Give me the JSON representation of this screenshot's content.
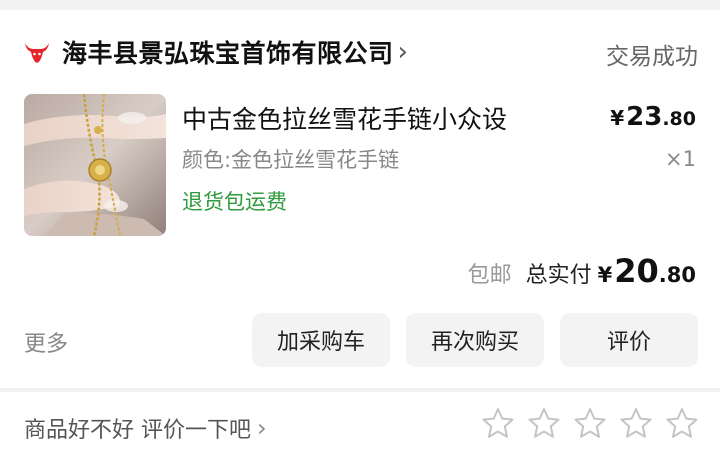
{
  "shop": {
    "name": "海丰县景弘珠宝首饰有限公司",
    "chevron": "›",
    "status": "交易成功"
  },
  "product": {
    "title": "中古金色拉丝雪花手链小众设",
    "variant": "颜色:金色拉丝雪花手链",
    "return_badge": "退货包运费",
    "price_symbol": "¥",
    "price_int": "23",
    "price_dec": ".80",
    "quantity": "×1"
  },
  "summary": {
    "shipping": "包邮",
    "total_label": "总实付",
    "total_symbol": "¥",
    "total_int": "20",
    "total_dec": ".80"
  },
  "actions": {
    "more": "更多",
    "add_to_cart": "加采购车",
    "buy_again": "再次购买",
    "review": "评价"
  },
  "review_prompt": {
    "text": "商品好不好 评价一下吧",
    "chevron": "›",
    "star_count": 5
  },
  "colors": {
    "brand_red": "#e5262a",
    "return_green": "#2f9a3e"
  },
  "icons": [
    "bull-logo-icon",
    "chevron-right-icon",
    "star-outline-icon"
  ]
}
